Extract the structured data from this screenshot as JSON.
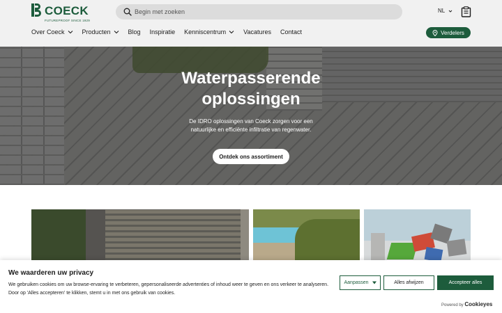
{
  "header": {
    "logo_text": "COECK",
    "logo_sub": "FUTUREPROOF SINCE 1929",
    "search_placeholder": "Begin met zoeken",
    "language": "NL",
    "distributors_label": "Verdelers"
  },
  "nav": {
    "items": [
      {
        "label": "Over Coeck",
        "has_dropdown": true
      },
      {
        "label": "Producten",
        "has_dropdown": true
      },
      {
        "label": "Blog",
        "has_dropdown": false
      },
      {
        "label": "Inspiratie",
        "has_dropdown": false
      },
      {
        "label": "Kenniscentrum",
        "has_dropdown": true
      },
      {
        "label": "Vacatures",
        "has_dropdown": false
      },
      {
        "label": "Contact",
        "has_dropdown": false
      }
    ]
  },
  "hero": {
    "title_line1": "Waterpasserende",
    "title_line2": "oplossingen",
    "text": "De IDRO oplossingen van Coeck zorgen voor een natuurlijke en efficiënte infiltratie van regenwater.",
    "cta_label": "Ontdek ons assortiment"
  },
  "cookie": {
    "title": "We waarderen uw privacy",
    "text": "We gebruiken cookies om uw browse-ervaring te verbeteren, gepersonaliseerde advertenties of inhoud weer te geven en ons verkeer te analyseren. Door op 'Alles accepteren' te klikken, stemt u in met ons gebruik van cookies.",
    "customize_label": "Aanpassen",
    "reject_label": "Alles afwijzen",
    "accept_label": "Accepteer alles",
    "powered_by": "Powered by",
    "powered_brand": "Cookieyes"
  },
  "colors": {
    "brand_green": "#1d5c3c",
    "header_bg": "#f1f1f1",
    "search_bg": "#dcdcdc"
  },
  "icons": [
    "search-icon",
    "chevron-down-icon",
    "clipboard-icon",
    "location-pin-icon",
    "caret-down-icon"
  ]
}
